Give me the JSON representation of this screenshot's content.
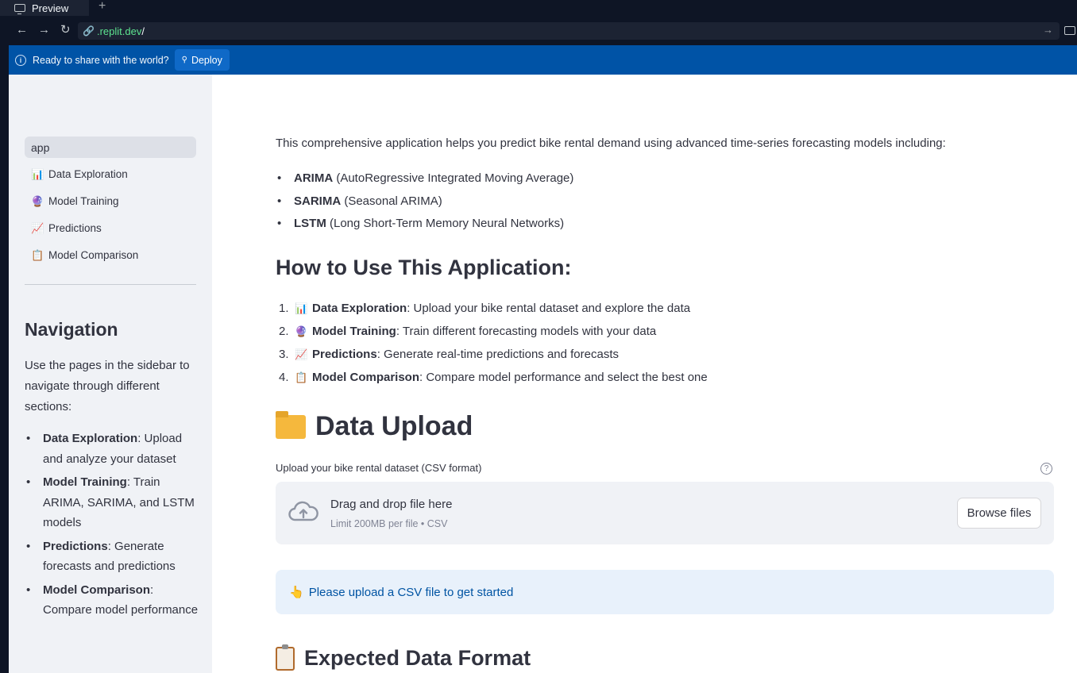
{
  "ide": {
    "tab_label": "Preview",
    "url_host": ".replit.dev",
    "url_path": "/",
    "banner_text": "Ready to share with the world?",
    "deploy_label": "Deploy"
  },
  "sidebar": {
    "nav": [
      {
        "label": "app",
        "icon": "",
        "active": true
      },
      {
        "label": "Data Exploration",
        "icon": "📊"
      },
      {
        "label": "Model Training",
        "icon": "🔮"
      },
      {
        "label": "Predictions",
        "icon": "📈"
      },
      {
        "label": "Model Comparison",
        "icon": "📋"
      }
    ],
    "heading": "Navigation",
    "intro": "Use the pages in the sidebar to navigate through different sections:",
    "items": [
      {
        "title": "Data Exploration",
        "desc": ": Upload and analyze your dataset"
      },
      {
        "title": "Model Training",
        "desc": ": Train ARIMA, SARIMA, and LSTM models"
      },
      {
        "title": "Predictions",
        "desc": ": Generate forecasts and predictions"
      },
      {
        "title": "Model Comparison",
        "desc": ":"
      },
      {
        "extra": "Compare model performance"
      }
    ]
  },
  "main": {
    "intro": "This comprehensive application helps you predict bike rental demand using advanced time-series forecasting models including:",
    "models": [
      {
        "name": "ARIMA",
        "desc": " (AutoRegressive Integrated Moving Average)"
      },
      {
        "name": "SARIMA",
        "desc": " (Seasonal ARIMA)"
      },
      {
        "name": "LSTM",
        "desc": " (Long Short-Term Memory Neural Networks)"
      }
    ],
    "howto_heading": "How to Use This Application:",
    "steps": [
      {
        "num": "1.",
        "icon": "📊",
        "title": "Data Exploration",
        "desc": ": Upload your bike rental dataset and explore the data"
      },
      {
        "num": "2.",
        "icon": "🔮",
        "title": "Model Training",
        "desc": ": Train different forecasting models with your data"
      },
      {
        "num": "3.",
        "icon": "📈",
        "title": "Predictions",
        "desc": ": Generate real-time predictions and forecasts"
      },
      {
        "num": "4.",
        "icon": "📋",
        "title": "Model Comparison",
        "desc": ": Compare model performance and select the best one"
      }
    ],
    "upload_heading": "Data Upload",
    "upload_label": "Upload your bike rental dataset (CSV format)",
    "dropzone_title": "Drag and drop file here",
    "dropzone_sub": "Limit 200MB per file • CSV",
    "browse_label": "Browse files",
    "info_icon": "👆",
    "info_text": "Please upload a CSV file to get started",
    "format_heading": "Expected Data Format"
  }
}
